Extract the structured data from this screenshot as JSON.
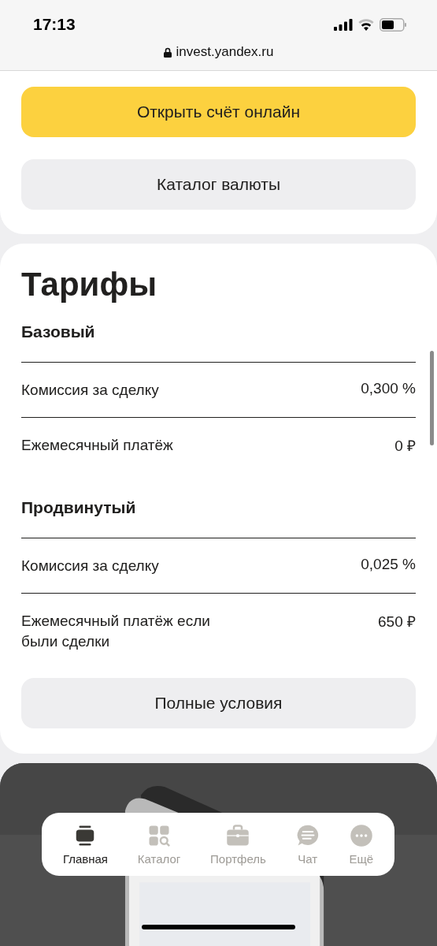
{
  "status_bar": {
    "time": "17:13"
  },
  "address_bar": {
    "url": "invest.yandex.ru"
  },
  "top_card": {
    "buttons": [
      {
        "label": "Открыть счёт онлайн",
        "kind": "primary"
      },
      {
        "label": "Каталог валюты",
        "kind": "secondary"
      }
    ]
  },
  "tariffs": {
    "title": "Тарифы",
    "plans": [
      {
        "name": "Базовый",
        "rows": [
          {
            "label": "Комиссия за сделку",
            "value": "0,300 %"
          },
          {
            "label": "Ежемесячный платёж",
            "value": "0 ₽"
          }
        ]
      },
      {
        "name": "Продвинутый",
        "rows": [
          {
            "label": "Комиссия за сделку",
            "value": "0,025 %"
          },
          {
            "label": "Ежемесячный платёж если были сделки",
            "value": "650 ₽"
          }
        ]
      }
    ],
    "button": "Полные условия"
  },
  "tab_bar": {
    "items": [
      {
        "label": "Главная",
        "selected": true
      },
      {
        "label": "Каталог",
        "selected": false
      },
      {
        "label": "Портфель",
        "selected": false
      },
      {
        "label": "Чат",
        "selected": false
      },
      {
        "label": "Ещё",
        "selected": false
      }
    ]
  }
}
